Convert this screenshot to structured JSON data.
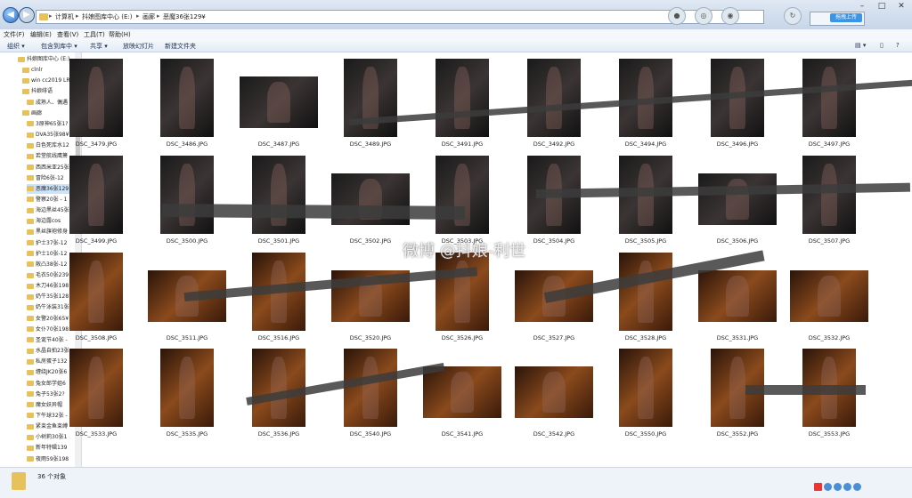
{
  "window": {
    "breadcrumbs": [
      "计算机",
      "抖娘图库中心 (E:)",
      "画廊",
      "恶魔36张129¥"
    ],
    "upload_button": "拖拽上传"
  },
  "menu": [
    "文件(F)",
    "编辑(E)",
    "查看(V)",
    "工具(T)",
    "帮助(H)"
  ],
  "toolbar": [
    "组织 ▾",
    "包含到库中 ▾",
    "共享 ▾",
    "放映幻灯片",
    "新建文件夹"
  ],
  "sidebar": {
    "items": [
      "抖娘图库中心 (E:)",
      "clnlr",
      "win cc2019 LR",
      "抖娘绯语",
      "成熟人、偶遇",
      "画廊",
      "3原神65张1?",
      "DVA35张98¥",
      "白色死库水12",
      "若堂航线鹰箫",
      "西西米亚25张",
      "冒险6张-12",
      "恶魔36张129",
      "警察20张 - 1",
      "海边黑丝45张",
      "海边露cos",
      "黑丝旗袍修身",
      "护士37张-12",
      "护士10张-12",
      "敞凸38张-12",
      "毛衣50张239",
      "木刀46张198",
      "奶牛35张128",
      "奶牛泳装31张",
      "女警20张65¥",
      "女仆70张198",
      "圣诞节40张 -",
      "水晶自拍23张",
      "私房蛋子132",
      "缠绕JK20张6",
      "兔女郎学姐6",
      "兔子53张2?",
      "魔女妖异帽",
      "下午球32张 -",
      "紧束金鱼束缚",
      "小树莉30张1",
      "新年特辑139",
      "夜雨59张198"
    ]
  },
  "files": [
    "DSC_3479.JPG",
    "DSC_3486.JPG",
    "DSC_3487.JPG",
    "DSC_3489.JPG",
    "DSC_3491.JPG",
    "DSC_3492.JPG",
    "DSC_3494.JPG",
    "DSC_3496.JPG",
    "DSC_3497.JPG",
    "DSC_3499.JPG",
    "DSC_3500.JPG",
    "DSC_3501.JPG",
    "DSC_3502.JPG",
    "DSC_3503.JPG",
    "DSC_3504.JPG",
    "DSC_3505.JPG",
    "DSC_3506.JPG",
    "DSC_3507.JPG",
    "DSC_3508.JPG",
    "DSC_3511.JPG",
    "DSC_3516.JPG",
    "DSC_3520.JPG",
    "DSC_3526.JPG",
    "DSC_3527.JPG",
    "DSC_3528.JPG",
    "DSC_3531.JPG",
    "DSC_3532.JPG",
    "DSC_3533.JPG",
    "DSC_3535.JPG",
    "DSC_3536.JPG",
    "DSC_3540.JPG",
    "DSC_3541.JPG",
    "DSC_3542.JPG",
    "DSC_3550.JPG",
    "DSC_3552.JPG",
    "DSC_3553.JPG"
  ],
  "status": {
    "count": "36 个对象"
  },
  "watermark": "微博 @抖娘-利世",
  "colors": {
    "accent": "#3b94e6",
    "folder": "#e7c25c"
  }
}
